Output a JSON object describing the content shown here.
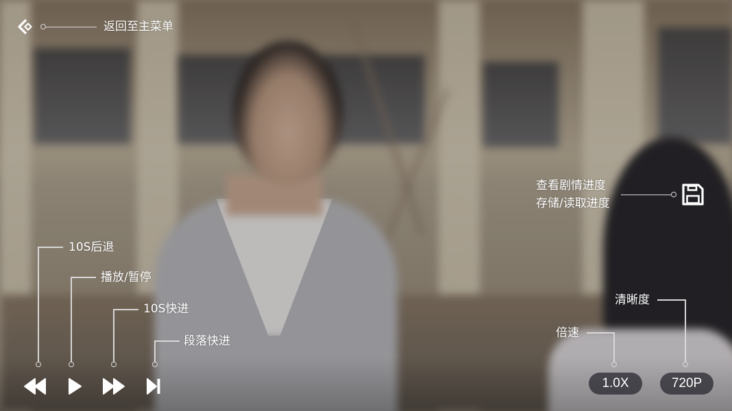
{
  "back": {
    "label": "返回至主菜单"
  },
  "progress_hint": {
    "line1": "查看剧情进度",
    "line2": "存储/读取进度"
  },
  "controls": {
    "rewind_label": "10S后退",
    "play_label": "播放/暂停",
    "forward_label": "10S快进",
    "skip_label": "段落快进"
  },
  "right": {
    "speed_label": "倍速",
    "quality_label": "清晰度",
    "speed_value": "1.0X",
    "quality_value": "720P"
  },
  "colors": {
    "line": "#d8d8d8",
    "pill_bg": "#282830"
  },
  "icons": [
    "back-arrow-icon",
    "save-icon",
    "rewind-icon",
    "play-icon",
    "fast-forward-icon",
    "skip-next-icon"
  ]
}
